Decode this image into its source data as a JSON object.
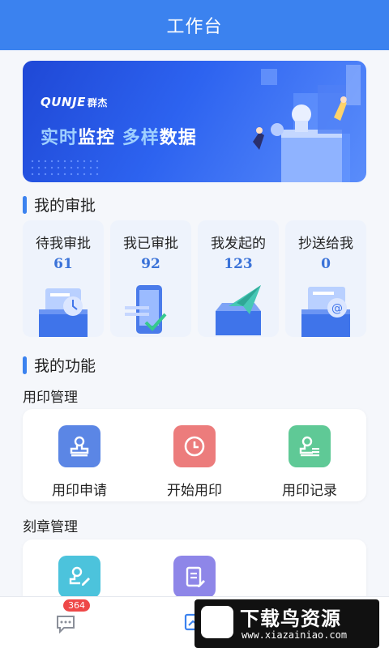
{
  "header": {
    "title": "工作台"
  },
  "banner": {
    "brand_en": "QUNJE",
    "brand_cn": "群杰",
    "slogan_part1": "实时",
    "slogan_part2": "监控",
    "slogan_part3": "多样",
    "slogan_part4": "数据"
  },
  "approval": {
    "title": "我的审批",
    "items": [
      {
        "label": "待我审批",
        "count": "61",
        "icon": "pending-document-clock-icon"
      },
      {
        "label": "我已审批",
        "count": "92",
        "icon": "approved-phone-check-icon"
      },
      {
        "label": "我发起的",
        "count": "123",
        "icon": "sent-box-paper-plane-icon"
      },
      {
        "label": "抄送给我",
        "count": "0",
        "icon": "cc-mail-at-icon"
      }
    ]
  },
  "functions": {
    "title": "我的功能",
    "groups": [
      {
        "name": "用印管理",
        "items": [
          {
            "label": "用印申请",
            "icon": "seal-apply-icon",
            "color": "#5b86e5"
          },
          {
            "label": "开始用印",
            "icon": "seal-start-clock-icon",
            "color": "#ec7c7c"
          },
          {
            "label": "用印记录",
            "icon": "seal-record-icon",
            "color": "#5fc996"
          }
        ]
      },
      {
        "name": "刻章管理",
        "items": [
          {
            "label": "",
            "icon": "seal-carve-apply-icon",
            "color": "#4cc3dc"
          },
          {
            "label": "",
            "icon": "seal-carve-document-icon",
            "color": "#8e86e8"
          }
        ]
      }
    ]
  },
  "tabbar": {
    "messages_badge": "364",
    "items": [
      {
        "icon": "message-icon"
      },
      {
        "icon": "workbench-icon"
      }
    ]
  },
  "watermark": {
    "text": "下载鸟资源",
    "url": "www.xiazainiao.com"
  },
  "colors": {
    "primary": "#3b82ef",
    "number": "#3a72d8",
    "badge": "#ee4848"
  }
}
